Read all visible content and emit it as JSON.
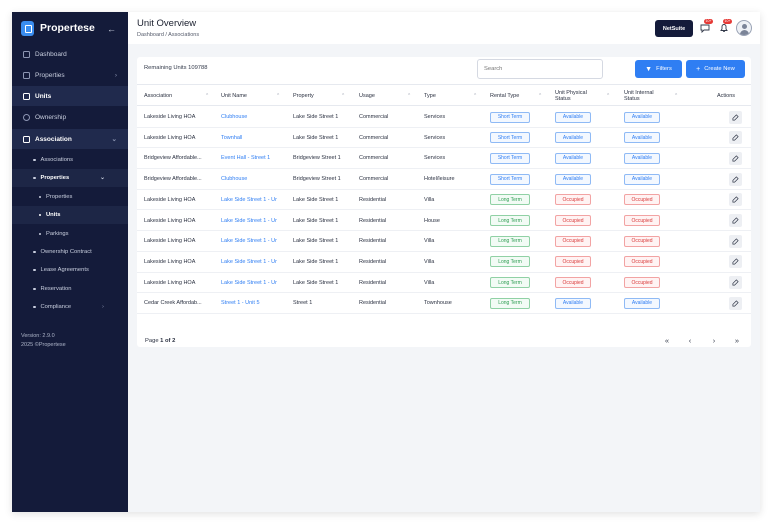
{
  "sidebar": {
    "brand": "Propertese",
    "nav": [
      {
        "label": "Dashboard",
        "icon": "dashboard-icon"
      },
      {
        "label": "Properties",
        "icon": "building-icon"
      },
      {
        "label": "Units",
        "icon": "units-icon"
      },
      {
        "label": "Ownership",
        "icon": "ownership-icon"
      },
      {
        "label": "Association",
        "icon": "document-icon"
      }
    ],
    "sub": [
      {
        "label": "Associations"
      },
      {
        "label": "Properties"
      },
      {
        "label": "Properties"
      },
      {
        "label": "Units"
      },
      {
        "label": "Parkings"
      },
      {
        "label": "Ownership Contract"
      },
      {
        "label": "Lease Agreements"
      },
      {
        "label": "Reservation"
      },
      {
        "label": "Compliance"
      }
    ],
    "version": "Version: 2.9.0",
    "copyright": "2025 ©Propertese"
  },
  "header": {
    "title": "Unit Overview",
    "breadcrumb": "Dashboard / Associations",
    "netsuite": "NetSuite",
    "badge1": "10+",
    "badge2": "10+"
  },
  "toolbar": {
    "remaining": "Remaining Units 109788",
    "search_placeholder": "Search",
    "filters": "Filters",
    "create": "Create New"
  },
  "table": {
    "columns": [
      "Association",
      "Unit Name",
      "Property",
      "Usage",
      "Type",
      "Rental Type",
      "Unit Physical Status",
      "Unit Internal Status",
      "Actions"
    ],
    "rows": [
      [
        "Lakeside Living HOA",
        "Clubhouse",
        "Lake Side Street 1",
        "Commercial",
        "Services",
        "Short Term",
        "Available",
        "Available"
      ],
      [
        "Lakeside Living HOA",
        "Townhall",
        "Lake Side Street 1",
        "Commercial",
        "Services",
        "Short Term",
        "Available",
        "Available"
      ],
      [
        "Bridgeview Affordable...",
        "Event Hall - Street 1",
        "Bridgeview Street 1",
        "Commercial",
        "Services",
        "Short Term",
        "Available",
        "Available"
      ],
      [
        "Bridgeview Affordable...",
        "Clubhouse",
        "Bridgeview Street 1",
        "Commercial",
        "Hotel/leisure",
        "Short Term",
        "Available",
        "Available"
      ],
      [
        "Lakeside Living HOA",
        "Lake Side Street 1 - Ur",
        "Lake Side Street 1",
        "Residential",
        "Villa",
        "Long Term",
        "Occupied",
        "Occupied"
      ],
      [
        "Lakeside Living HOA",
        "Lake Side Street 1 - Ur",
        "Lake Side Street 1",
        "Residential",
        "House",
        "Long Term",
        "Occupied",
        "Occupied"
      ],
      [
        "Lakeside Living HOA",
        "Lake Side Street 1 - Ur",
        "Lake Side Street 1",
        "Residential",
        "Villa",
        "Long Term",
        "Occupied",
        "Occupied"
      ],
      [
        "Lakeside Living HOA",
        "Lake Side Street 1 - Ur",
        "Lake Side Street 1",
        "Residential",
        "Villa",
        "Long Term",
        "Occupied",
        "Occupied"
      ],
      [
        "Lakeside Living HOA",
        "Lake Side Street 1 - Ur",
        "Lake Side Street 1",
        "Residential",
        "Villa",
        "Long Term",
        "Occupied",
        "Occupied"
      ],
      [
        "Cedar Creek Affordab...",
        "Street 1 - Unit 5",
        "Street 1",
        "Residential",
        "Townhouse",
        "Long Term",
        "Available",
        "Available"
      ]
    ]
  },
  "pagination": {
    "prefix": "Page ",
    "current": "1 of 2"
  }
}
